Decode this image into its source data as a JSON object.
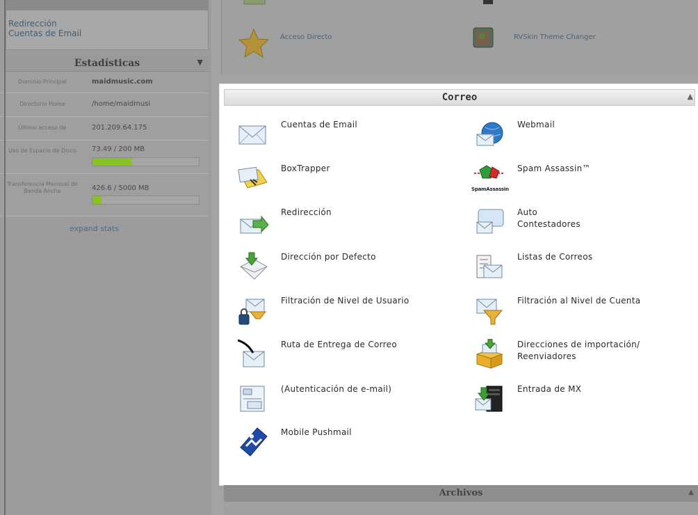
{
  "sidebar": {
    "links": [
      "Redirección",
      "Cuentas de Email"
    ],
    "stats_title": "Estadísticas",
    "stats": [
      {
        "label": "Dominio Principal",
        "value": "maidmusic.com"
      },
      {
        "label": "Directorio Home",
        "value": "/home/maidmusi"
      },
      {
        "label": "Último acceso de",
        "value": "201.209.64.175"
      },
      {
        "label": "Uso de Espacio de Disco",
        "value": "73.49 / 200 MB",
        "fraction": 0.37
      },
      {
        "label": "Transferencia Mensual de Banda Ancha",
        "value": "426.6 / 5000 MB",
        "fraction": 0.085
      }
    ],
    "expand_label": "expand stats"
  },
  "top_panel": {
    "items": [
      "Acceso Directo",
      "RVSkin Theme Changer"
    ]
  },
  "correo": {
    "title": "Correo",
    "items": [
      {
        "label": "Cuentas de Email",
        "icon": "envelope-icon"
      },
      {
        "label": "Webmail",
        "icon": "webmail-globe-icon"
      },
      {
        "label": "BoxTrapper",
        "icon": "boxtrapper-icon"
      },
      {
        "label": "Spam Assassin™",
        "icon": "spam-assassin-icon",
        "caption": "SpamAssassin"
      },
      {
        "label": "Redirección",
        "icon": "forward-envelope-icon"
      },
      {
        "label": "Auto Contestadores",
        "icon": "autoresponder-icon"
      },
      {
        "label": "Dirección por Defecto",
        "icon": "default-address-icon"
      },
      {
        "label": "Listas de Correos",
        "icon": "mailing-list-icon"
      },
      {
        "label": "Filtración de Nivel de Usuario",
        "icon": "user-filter-icon"
      },
      {
        "label": "Filtración al Nivel de Cuenta",
        "icon": "account-filter-icon"
      },
      {
        "label": "Ruta de Entrega de Correo",
        "icon": "delivery-route-icon"
      },
      {
        "label": "Direcciones de importación/ Reenviadores",
        "icon": "import-addresses-icon"
      },
      {
        "label": "(Autenticación de e-mail)",
        "icon": "email-auth-icon"
      },
      {
        "label": "Entrada de MX",
        "icon": "mx-entry-icon"
      },
      {
        "label": "Mobile Pushmail",
        "icon": "pushmail-icon"
      }
    ]
  },
  "bottom_panel": {
    "title": "Archivos"
  },
  "colors": {
    "accent_green": "#86c321",
    "overlay_gray": "#a3a3a3",
    "panel_white": "#ffffff"
  }
}
